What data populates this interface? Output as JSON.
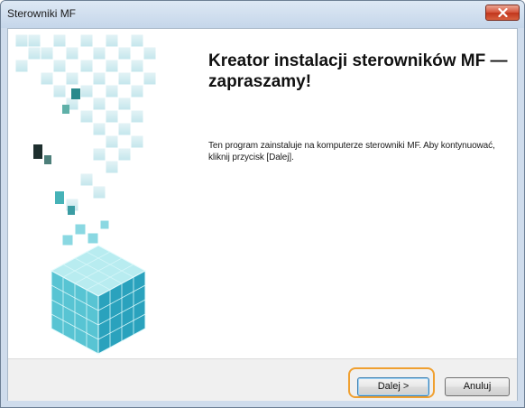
{
  "window": {
    "title": "Sterowniki MF"
  },
  "wizard": {
    "heading": "Kreator instalacji sterowników MF — zapraszamy!",
    "description": "Ten program zainstaluje na komputerze sterowniki MF. Aby kontynuować, kliknij przycisk [Dalej]."
  },
  "buttons": {
    "next_label": "Dalej >",
    "cancel_label": "Anuluj"
  },
  "icons": {
    "close": "close-icon",
    "banner": "cube-graphic"
  },
  "colors": {
    "highlight": "#f0a030",
    "cube_teal": "#3fb8c8",
    "close_button": "#c94a30"
  }
}
